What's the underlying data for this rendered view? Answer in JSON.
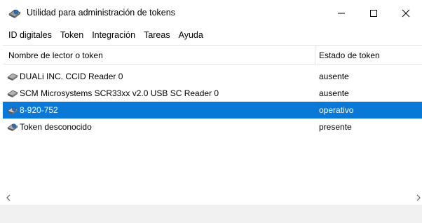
{
  "window": {
    "title": "Utilidad para administración de tokens",
    "app_icon": "token-utility-icon"
  },
  "menu": [
    {
      "label": "ID digitales"
    },
    {
      "label": "Token"
    },
    {
      "label": "Integración"
    },
    {
      "label": "Tareas"
    },
    {
      "label": "Ayuda"
    }
  ],
  "table": {
    "columns": [
      "Nombre de lector o token",
      "Estado de token"
    ],
    "rows": [
      {
        "name": "DUALi INC. CCID Reader 0",
        "state": "ausente",
        "icon": "reader-icon",
        "selected": false
      },
      {
        "name": "SCM Microsystems SCR33xx v2.0 USB SC Reader 0",
        "state": "ausente",
        "icon": "reader-icon",
        "selected": false
      },
      {
        "name": "8-920-752",
        "state": "operativo",
        "icon": "token-icon",
        "selected": true
      },
      {
        "name": "Token desconocido",
        "state": "presente",
        "icon": "token-icon",
        "selected": false
      }
    ]
  },
  "colors": {
    "selection": "#0a78d7",
    "token_blue": "#2f6db5"
  }
}
